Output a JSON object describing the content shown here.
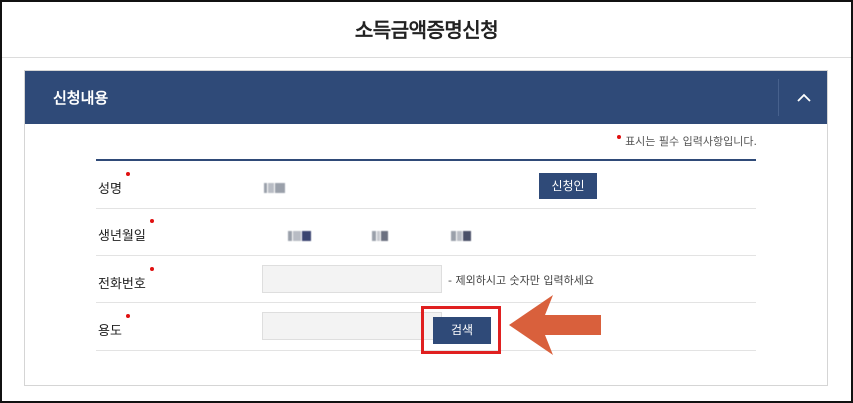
{
  "page": {
    "title": "소득금액증명신청"
  },
  "panel": {
    "title": "신청내용",
    "collapse_icon": "chevron-up-icon",
    "required_note": "표시는 필수 입력사항입니다."
  },
  "form": {
    "name": {
      "label": "성명",
      "applicant_button": "신청인"
    },
    "birthdate": {
      "label": "생년월일"
    },
    "phone": {
      "label": "전화번호",
      "hint": "- 제외하시고 숫자만 입력하세요"
    },
    "purpose": {
      "label": "용도",
      "search_button": "검색"
    }
  },
  "colors": {
    "header": "#2f4a78",
    "required_dot": "#e01010",
    "highlight": "#e02020",
    "arrow": "#d9603c"
  }
}
